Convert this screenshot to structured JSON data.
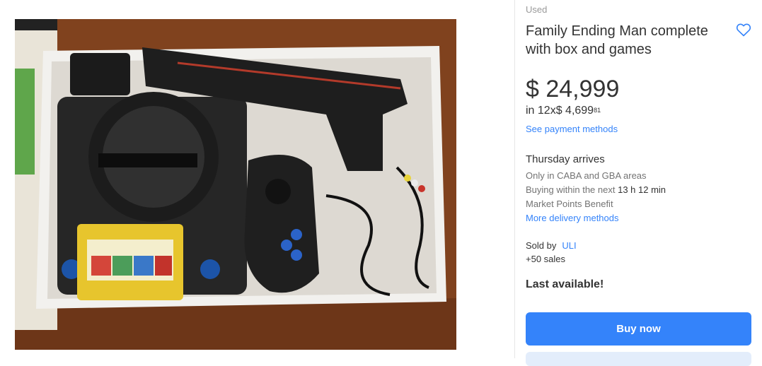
{
  "product": {
    "condition": "Used",
    "title": "Family Ending Man complete with box and games",
    "price": "$ 24,999",
    "installments_prefix": "in 12x$ 4,699",
    "installments_cents": "81",
    "payment_link": "See payment methods"
  },
  "shipping": {
    "arrives": "Thursday arrives",
    "area_note": "Only in CABA and GBA areas",
    "buy_within_label": "Buying within the next",
    "buy_within_time": "13 h 12 min",
    "benefit": "Market Points Benefit",
    "more_link": "More delivery methods"
  },
  "seller": {
    "sold_by_label": "Sold by",
    "name": "ULI",
    "sales": "+50 sales"
  },
  "stock": "Last available!",
  "actions": {
    "buy_now": "Buy now"
  },
  "icons": {
    "favorite": "heart-outline-icon"
  },
  "colors": {
    "accent": "#3483fa",
    "muted": "#737373",
    "text": "#333333"
  }
}
